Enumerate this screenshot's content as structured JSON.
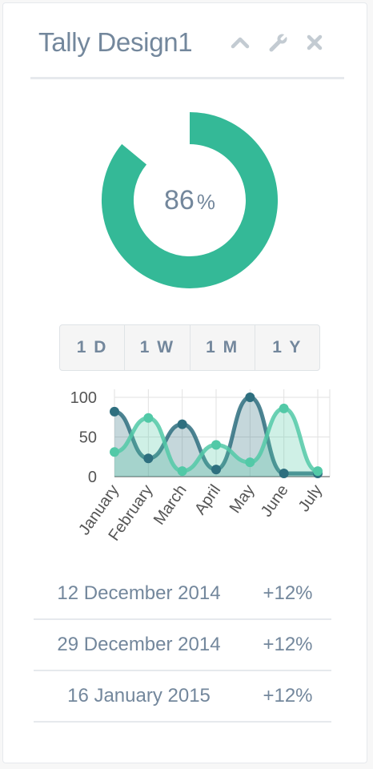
{
  "widget": {
    "title": "Tally Design1",
    "icons": [
      "chevron-up-icon",
      "wrench-icon",
      "close-icon"
    ]
  },
  "donut": {
    "value": 86,
    "value_text": "86",
    "unit": "%",
    "color": "#34b997",
    "track_color": "#ffffff"
  },
  "range_buttons": [
    {
      "label": "1 D"
    },
    {
      "label": "1 W"
    },
    {
      "label": "1 M"
    },
    {
      "label": "1 Y"
    }
  ],
  "chart_data": {
    "type": "area",
    "categories": [
      "January",
      "February",
      "March",
      "April",
      "May",
      "June",
      "July"
    ],
    "ylim": [
      0,
      100
    ],
    "yticks": [
      0,
      50,
      100
    ],
    "grid": true,
    "series": [
      {
        "color": "#2e6f7f",
        "values": [
          82,
          23,
          66,
          9,
          100,
          4,
          4
        ]
      },
      {
        "color": "#52c9a7",
        "values": [
          31,
          74,
          7,
          40,
          18,
          86,
          7
        ]
      }
    ]
  },
  "stats": [
    {
      "date": "12 December 2014",
      "change": "+12%"
    },
    {
      "date": "29 December 2014",
      "change": "+12%"
    },
    {
      "date": "16 January 2015",
      "change": "+12%"
    }
  ]
}
